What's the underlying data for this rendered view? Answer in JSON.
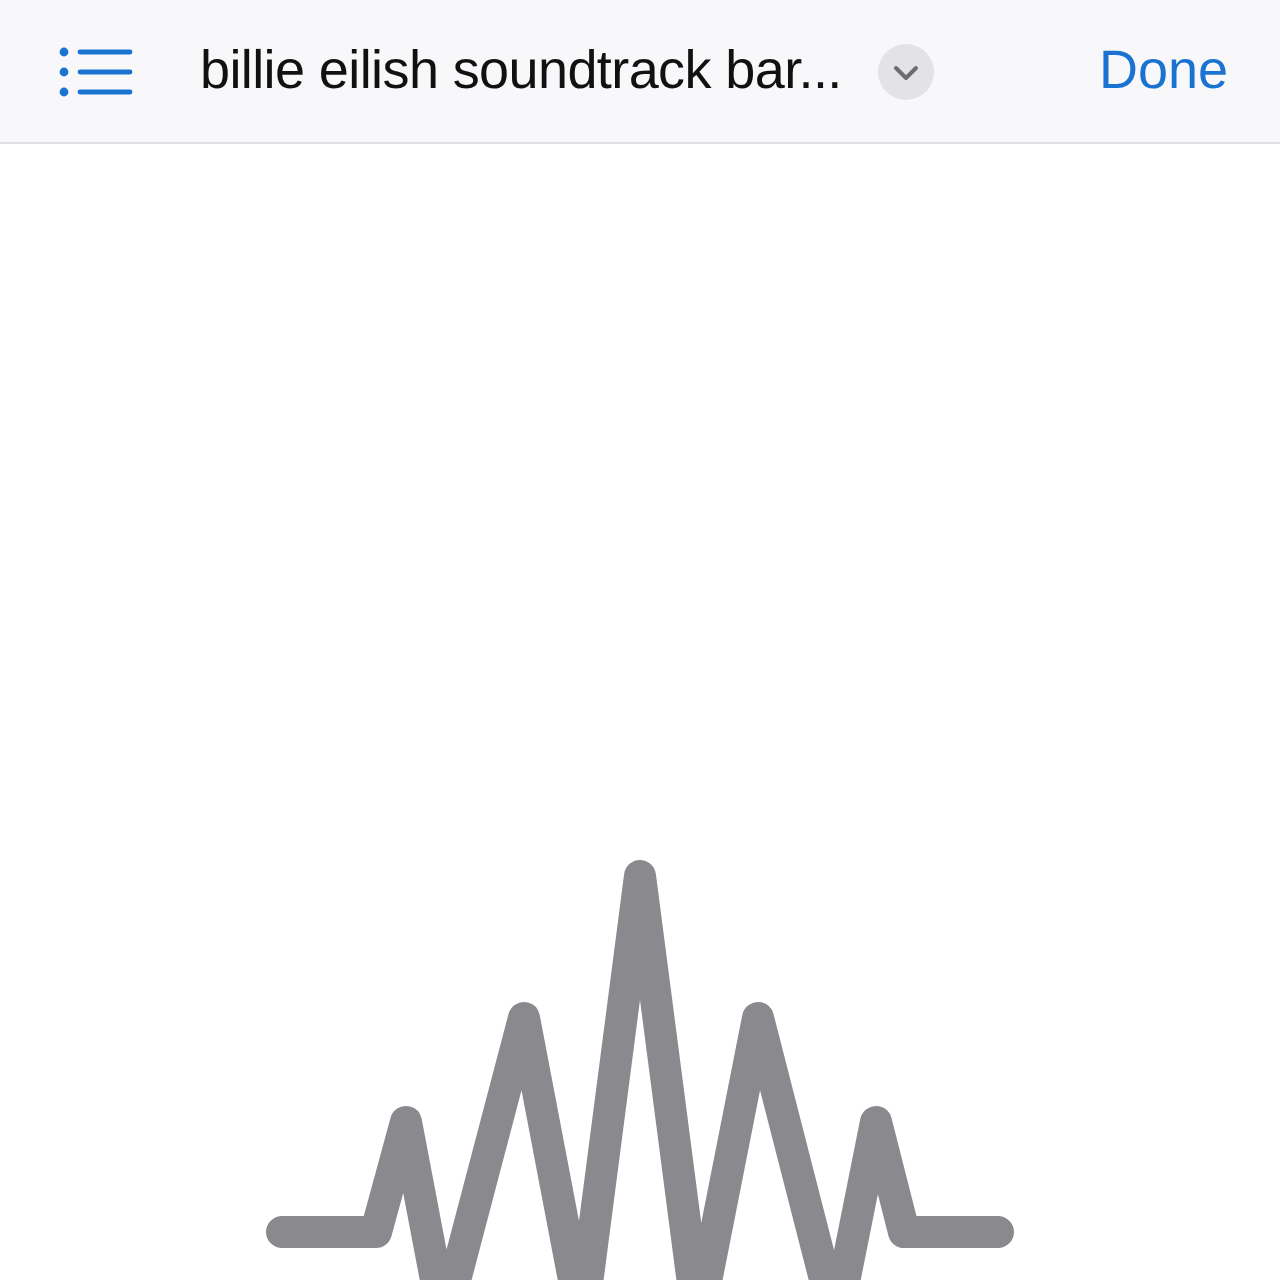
{
  "nav_bar": {
    "title": "billie eilish soundtrack bar...",
    "done_button": "Done"
  }
}
